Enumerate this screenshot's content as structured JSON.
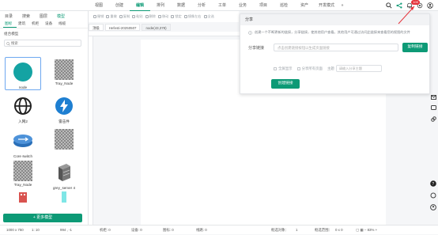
{
  "menu": [
    "视图",
    "创建",
    "编辑",
    "排列",
    "数据",
    "分析",
    "工单",
    "业务",
    "项目",
    "巡检",
    "资产",
    "开发模式"
  ],
  "menu_active": 2,
  "menu_more": "»",
  "notify_badge": "100",
  "toolbar": [
    "撤销",
    "重做",
    "复制",
    "粘贴",
    "删除",
    "移动",
    "锁定",
    "镜像左右",
    "全选"
  ],
  "left": {
    "tabs": [
      "目录",
      "搜索",
      "图层",
      "模型"
    ],
    "active_tab": 3,
    "subtabs": [
      "图标",
      "建筑",
      "机柜",
      "设备",
      "线缆"
    ],
    "active_subtab": 0,
    "section_title": "组合模型",
    "search_placeholder": "搜索",
    "models": [
      {
        "label": "node",
        "kind": "circle"
      },
      {
        "label": "Tray_Node",
        "kind": "checker"
      },
      {
        "label": "入网2",
        "kind": "globe"
      },
      {
        "label": "雷击件",
        "kind": "bolt"
      },
      {
        "label": "Core switch",
        "kind": "switch"
      },
      {
        "label": "",
        "kind": "checker"
      },
      {
        "label": "Tray_Node",
        "kind": "checker"
      },
      {
        "label": "grey_server 4",
        "kind": "server"
      }
    ],
    "more_button": "+ 更多模型"
  },
  "doc_tabs": [
    "顶级",
    "Hefesti-20250507",
    "node(43,378)"
  ],
  "share": {
    "title": "分享",
    "note": "创建一个不断更新的链接，分享链接，使其他用户查看。其他用户可通过访问此链接来查看您的视图的文件",
    "link_label": "分享链接",
    "link_placeholder": "点击创建链接按钮以生成页面链接",
    "copy_button": "复制链接",
    "opt_fullscreen": "全屏显示",
    "opt_share_all": "分享所有页面",
    "theme_label": "主题",
    "theme_placeholder": "请输入分享主题",
    "create_button": "创建链接"
  },
  "status": {
    "size": "1000 x 750",
    "scale": "1: 10",
    "coords": "994 , -1",
    "machines": "机柜: 0",
    "devices": "设备: 0",
    "icons": "图标: 0",
    "cables": "线路: 0",
    "selected": "框选对象：",
    "selected_count": "1",
    "range": "框选范围：",
    "range_val": "0 x 0",
    "zoom": "83%"
  },
  "colors": {
    "accent": "#0d9a76",
    "badge": "#e5323a",
    "node": "#14a3a3"
  }
}
